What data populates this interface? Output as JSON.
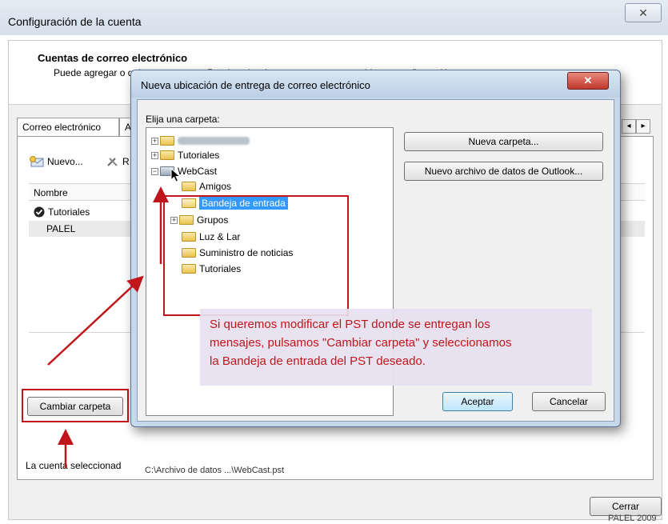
{
  "main_window": {
    "title": "Configuración de la cuenta",
    "close_glyph": "✕",
    "header_title": "Cuentas de correo electrónico",
    "header_subtitle": "Puede agregar o quitar una cuenta. Puede seleccionar una cuenta y cambiar su configuración.",
    "tabs": [
      "Correo electrónico",
      "A"
    ],
    "toolbar": {
      "new_label": "Nuevo...",
      "repair_label": "R"
    },
    "list_column": "Nombre",
    "accounts": [
      {
        "name": "Tutoriales",
        "default": true
      },
      {
        "name": "PALEL",
        "default": false
      }
    ],
    "selected_account_label": "La cuenta seleccionad",
    "change_folder_button": "Cambiar carpeta",
    "pst_path": "C:\\Archivo de datos ...\\WebCast.pst",
    "close_button": "Cerrar",
    "watermark": "PALEL 2009"
  },
  "dialog": {
    "title": "Nueva ubicación de entrega de correo electrónico",
    "close_glyph": "✕",
    "folder_label": "Elija una carpeta:",
    "tree": {
      "top_items": [
        "Tutoriales"
      ],
      "webcast_root": "WebCast",
      "webcast_children": [
        "Amigos",
        "Bandeja de entrada",
        "Grupos",
        "Luz & Lar",
        "Suministro de noticias",
        "Tutoriales"
      ],
      "selected": "Bandeja de entrada"
    },
    "new_folder_button": "Nueva carpeta...",
    "new_data_file_button": "Nuevo archivo de datos de Outlook...",
    "ok_button": "Aceptar",
    "cancel_button": "Cancelar"
  },
  "callout": {
    "line1": "Si queremos modificar el PST donde se entregan los",
    "line2": "mensajes, pulsamos \"Cambiar carpeta\" y seleccionamos",
    "line3": "la Bandeja de entrada del PST deseado."
  },
  "colors": {
    "annotation_red": "#c0161b",
    "selection_blue": "#3399ff"
  }
}
